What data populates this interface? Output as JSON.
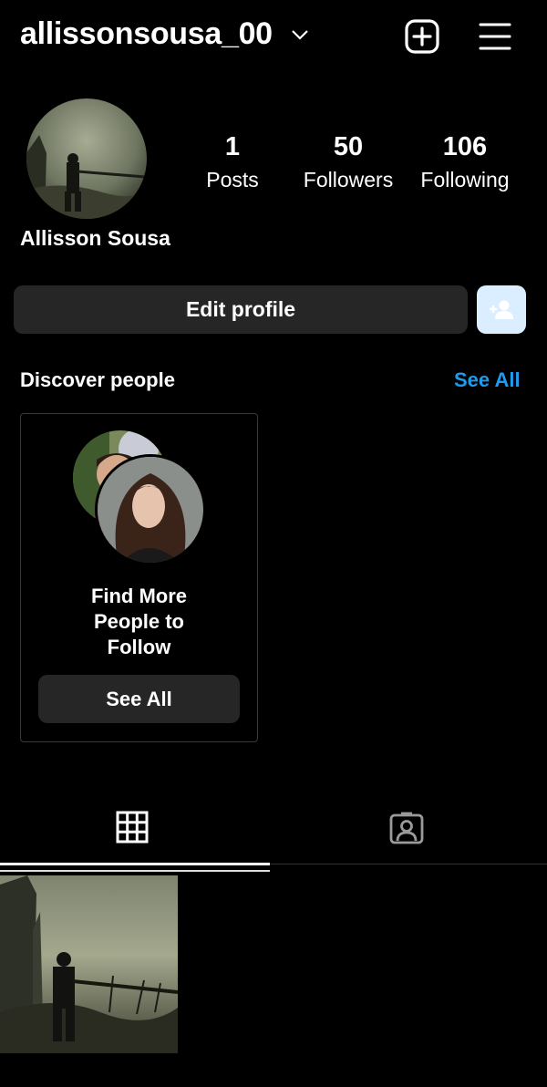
{
  "header": {
    "username": "allissonsousa_00",
    "icons": [
      "chevron-down-icon",
      "plus-square-icon",
      "hamburger-menu-icon"
    ]
  },
  "profile": {
    "full_name": "Allisson Sousa",
    "stats": [
      {
        "value": "1",
        "label": "Posts"
      },
      {
        "value": "50",
        "label": "Followers"
      },
      {
        "value": "106",
        "label": "Following"
      }
    ],
    "edit_label": "Edit profile"
  },
  "discover": {
    "title": "Discover people",
    "see_all": "See All",
    "card_text": "Find More People to Follow",
    "card_button": "See All"
  },
  "tabs": [
    {
      "icon": "grid-icon",
      "active": true
    },
    {
      "icon": "tagged-person-icon",
      "active": false
    }
  ],
  "colors": {
    "background": "#000000",
    "button_bg": "#262626",
    "link_blue": "#1d9bf0",
    "add_user_bg": "#dbeeff"
  }
}
